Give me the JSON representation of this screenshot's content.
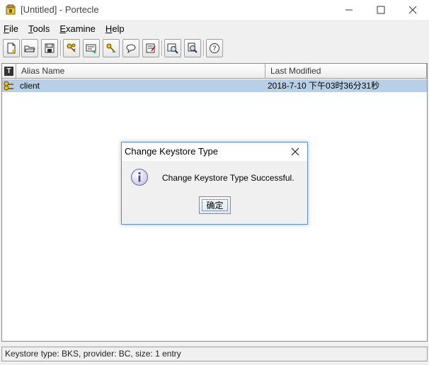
{
  "window": {
    "title": "[Untitled] - Portecle",
    "controls": [
      "minimize-icon",
      "maximize-icon",
      "close-icon"
    ]
  },
  "menu": {
    "items": [
      {
        "mnemonic": "F",
        "rest": "ile"
      },
      {
        "mnemonic": "T",
        "rest": "ools"
      },
      {
        "mnemonic": "E",
        "rest": "xamine"
      },
      {
        "mnemonic": "H",
        "rest": "elp"
      }
    ]
  },
  "toolbar": {
    "buttons": [
      "new-keystore-icon",
      "open-keystore-icon",
      "save-keystore-icon",
      "generate-keypair-icon",
      "import-trusted-cert-icon",
      "import-keypair-icon",
      "change-keystore-type-icon",
      "keystore-report-icon",
      "examine-certificate-icon",
      "examine-crl-icon",
      "help-icon"
    ]
  },
  "table": {
    "headers": {
      "type": "T",
      "alias": "Alias Name",
      "modified": "Last Modified"
    },
    "rows": [
      {
        "icon": "keypair-entry-icon",
        "alias": "client",
        "modified": "2018-7-10 下午03时36分31秒"
      }
    ]
  },
  "status": "Keystore type: BKS, provider: BC, size: 1 entry",
  "dialog": {
    "title": "Change Keystore Type",
    "message": "Change Keystore Type Successful.",
    "ok_label": "确定",
    "icon": "information-icon"
  },
  "colors": {
    "selection": "#b8cfe5",
    "dialog_border": "#5b8fc9"
  }
}
